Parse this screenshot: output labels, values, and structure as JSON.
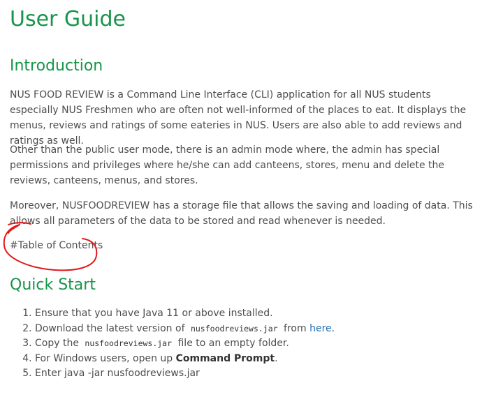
{
  "title": "User Guide",
  "intro": {
    "heading": "Introduction",
    "paragraphs": [
      "NUS FOOD REVIEW is a Command Line Interface (CLI) application for all NUS students especially NUS Freshmen who are often not well-informed of the places to eat. It displays the menus, reviews and ratings of some eateries in NUS. Users are also able to add reviews and ratings as well.",
      "Other than the public user mode, there is an admin mode where, the admin has special permissions and privileges where he/she can add canteens, stores, menu and delete the reviews, canteens, menus, and stores.",
      "Moreover, NUSFOODREVIEW has a storage file that allows the saving and loading of data. This allows all parameters of the data to be stored and read whenever is needed."
    ],
    "toc_text": "#Table of Contents"
  },
  "quickstart": {
    "heading": "Quick Start",
    "step1": "Ensure that you have Java 11 or above installed.",
    "step2_before": "Download the latest version of",
    "step2_code": "nusfoodreviews.jar",
    "step2_middle": "from",
    "step2_link": "here",
    "step2_after": ".",
    "step3_before": "Copy the",
    "step3_code": "nusfoodreviews.jar",
    "step3_after": "file to an empty folder.",
    "step4_before": "For Windows users, open up",
    "step4_bold": "Command Prompt",
    "step4_after": ".",
    "step5": "Enter java -jar nusfoodreviews.jar"
  },
  "annotation": {
    "color": "#e0191c",
    "shape": "hand-drawn circle around Table of Contents"
  }
}
